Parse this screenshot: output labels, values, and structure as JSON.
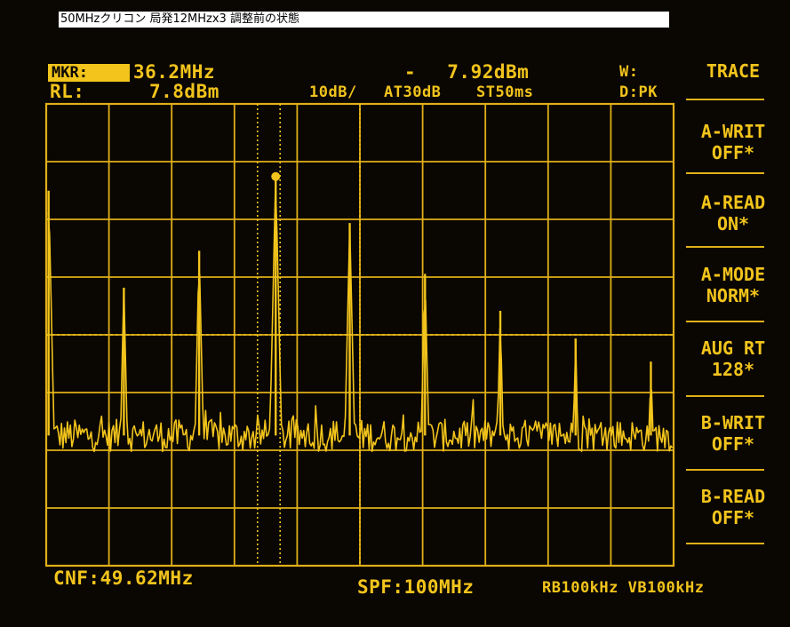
{
  "caption": "50MHzクリコン 局発12MHzx3 調整前の状態",
  "header": {
    "marker_tag": "MKR:",
    "marker_freq": "36.2MHz",
    "ref_label": "RL:",
    "ref_value": "7.8dBm",
    "marker_level": "- 7.92dBm",
    "scale": "10dB/",
    "atten": "AT30dB",
    "sweep": "ST50ms",
    "w_label": "W:",
    "detect": "D:PK"
  },
  "menu": {
    "title": "TRACE",
    "items": [
      {
        "line1": "A-WRIT",
        "line2": "OFF*"
      },
      {
        "line1": "A-READ",
        "line2": "ON*"
      },
      {
        "line1": "A-MODE",
        "line2": "NORM*"
      },
      {
        "line1": "AUG RT",
        "line2": "128*"
      },
      {
        "line1": "B-WRIT",
        "line2": "OFF*"
      },
      {
        "line1": "B-READ",
        "line2": "OFF*"
      }
    ]
  },
  "footer": {
    "center_freq": "CNF:49.62MHz",
    "span": "SPF:100MHz",
    "bandwidth": "RB100kHz VB100kHz"
  },
  "colors": {
    "trace": "#f2c41c",
    "background": "#0a0602",
    "grid": "#e0b018"
  },
  "chart_data": {
    "type": "line",
    "title": "",
    "xlabel": "",
    "ylabel": "",
    "xlim": [
      -0.38,
      99.62
    ],
    "ylim": [
      -92.2,
      7.8
    ],
    "ref_level_dbm": 7.8,
    "db_per_div": 10,
    "marker": {
      "x": 36.2,
      "y": -7.92
    },
    "noise_floor_dbm": -64,
    "peaks": [
      {
        "x": 0.0,
        "y": -11
      },
      {
        "x": 12.0,
        "y": -32
      },
      {
        "x": 24.0,
        "y": -24
      },
      {
        "x": 36.2,
        "y": -7.92
      },
      {
        "x": 48.0,
        "y": -18
      },
      {
        "x": 60.0,
        "y": -29
      },
      {
        "x": 72.0,
        "y": -37
      },
      {
        "x": 84.0,
        "y": -43
      },
      {
        "x": 96.0,
        "y": -48
      }
    ]
  }
}
